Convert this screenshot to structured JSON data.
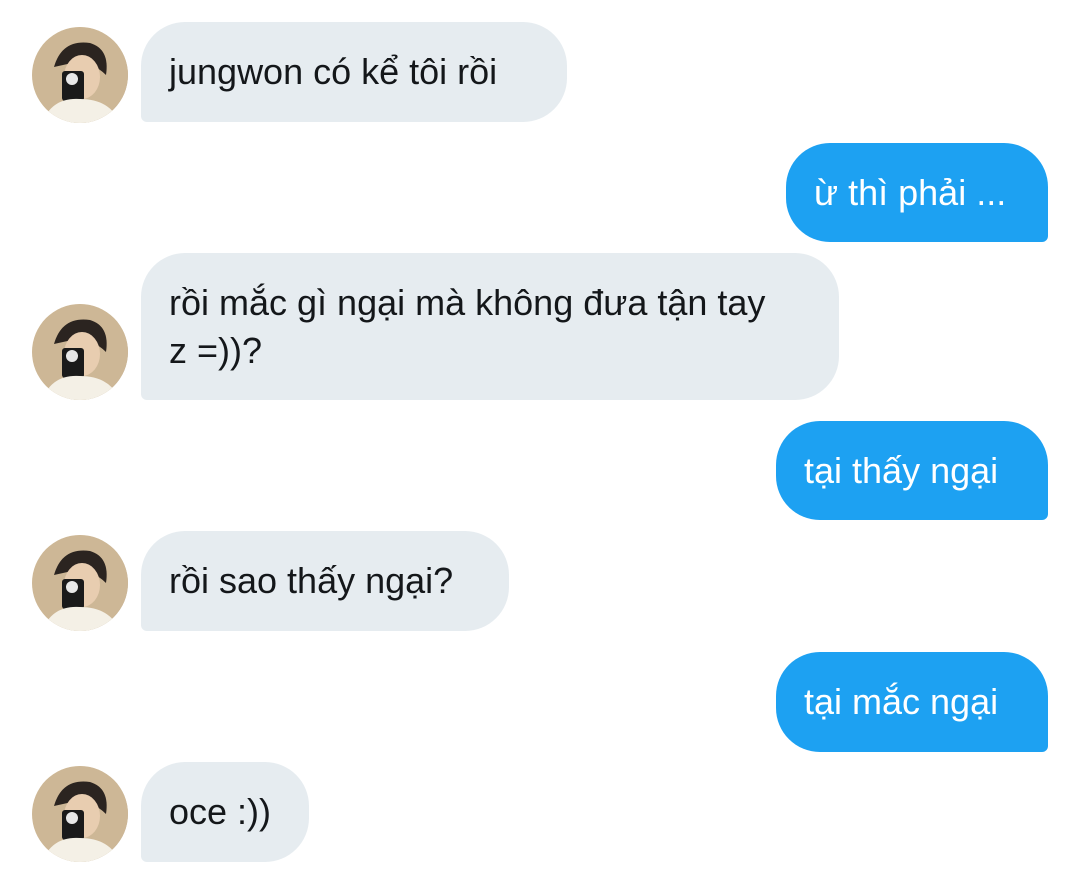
{
  "conversation": {
    "messages": [
      {
        "direction": "in",
        "text": "jungwon có kể tôi rồi"
      },
      {
        "direction": "out",
        "text": "ừ thì phải ..."
      },
      {
        "direction": "in",
        "text": "rồi mắc gì ngại mà không đưa tận tay z =))?"
      },
      {
        "direction": "out",
        "text": "tại thấy ngại"
      },
      {
        "direction": "in",
        "text": "rồi sao thấy ngại?"
      },
      {
        "direction": "out",
        "text": "tại mắc ngại"
      },
      {
        "direction": "in",
        "text": "oce :))"
      }
    ]
  },
  "colors": {
    "incoming_bubble": "#e6ecf0",
    "outgoing_bubble": "#1da1f2",
    "incoming_text": "#14171a",
    "outgoing_text": "#ffffff"
  },
  "icons": {
    "avatar": "profile-avatar"
  }
}
